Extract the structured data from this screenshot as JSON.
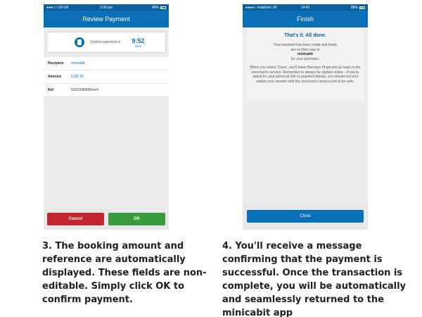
{
  "phone1": {
    "status": {
      "carrier": "●●●○○ O2-UK",
      "time": "2:39 pm",
      "battery": "48%",
      "battery_level": 0.48
    },
    "title": "Review Payment",
    "confirm": {
      "icon": "calculator-icon",
      "label": "Confirm payment in",
      "timer_value": "9:52",
      "timer_unit": "mins"
    },
    "details": [
      {
        "label": "Recipient",
        "value": "minicabit"
      },
      {
        "label": "Amount",
        "value": "£182.50"
      },
      {
        "label": "Ref",
        "value": "55423088880ee4"
      }
    ],
    "buttons": {
      "cancel": "Cancel",
      "ok": "OK"
    },
    "colors": {
      "header": "#0a6fb7",
      "cancel": "#c4262e",
      "ok": "#3a9a3e"
    }
  },
  "phone2": {
    "status": {
      "carrier": "●●●●○ vodafone UK",
      "time": "14:42",
      "battery": "88%",
      "battery_level": 0.88
    },
    "title": "Finish",
    "heading": "That's it. All done.",
    "message1": "Your payment has been made and funds are on their way to",
    "merchant": "minicabit",
    "message1_end": "for your purchase.",
    "message2": "When you select 'Close', you'll leave Barclays Pingit and go back to the merchant's service. Remember to always be vigilant online – if you're asked for your personal info or payment details, you should exit and restart your session with the merchant's service just to be safe.",
    "close_button": "Close"
  },
  "captions": {
    "step3": "3. The booking amount and reference are automatically displayed. These fields are non-editable. Simply click OK to confirm payment.",
    "step4": "4. You'll receive a message confirming that the payment is successful. Once the transaction is complete, you will be automatically and seamlessly returned to the minicabit app"
  }
}
